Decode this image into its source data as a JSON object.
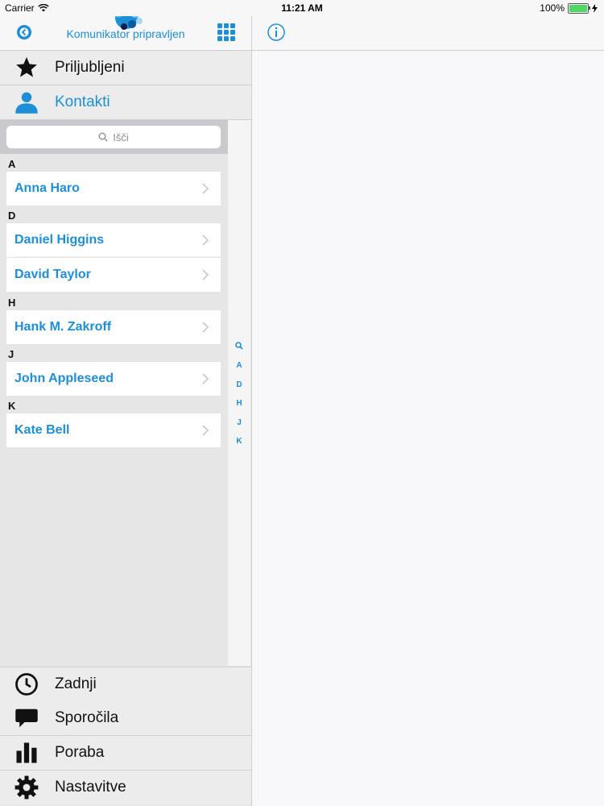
{
  "status": {
    "carrier": "Carrier",
    "time": "11:21 AM",
    "battery": "100%",
    "battery_level": 1.0
  },
  "header": {
    "title": "Komunikator pripravljen",
    "back_icon": "back-circle-icon",
    "grid_icon": "apps-grid-icon",
    "info_icon": "info-icon"
  },
  "top_menu": [
    {
      "label": "Priljubljeni",
      "icon": "star-icon",
      "active": false
    },
    {
      "label": "Kontakti",
      "icon": "person-icon",
      "active": true
    }
  ],
  "search": {
    "placeholder": "Išči"
  },
  "contacts": [
    {
      "letter": "A",
      "names": [
        "Anna Haro"
      ]
    },
    {
      "letter": "D",
      "names": [
        "Daniel Higgins",
        "David Taylor"
      ]
    },
    {
      "letter": "H",
      "names": [
        "Hank M. Zakroff"
      ]
    },
    {
      "letter": "J",
      "names": [
        "John Appleseed"
      ]
    },
    {
      "letter": "K",
      "names": [
        "Kate Bell"
      ]
    }
  ],
  "index": [
    "A",
    "D",
    "H",
    "J",
    "K"
  ],
  "bottom_menu": [
    {
      "label": "Zadnji",
      "icon": "clock-icon"
    },
    {
      "label": "Sporočila",
      "icon": "chat-bubble-icon"
    },
    {
      "label": "Poraba",
      "icon": "bar-chart-icon"
    },
    {
      "label": "Nastavitve",
      "icon": "gear-icon"
    }
  ],
  "colors": {
    "accent": "#1d8fd9",
    "battery": "#4cd964"
  }
}
